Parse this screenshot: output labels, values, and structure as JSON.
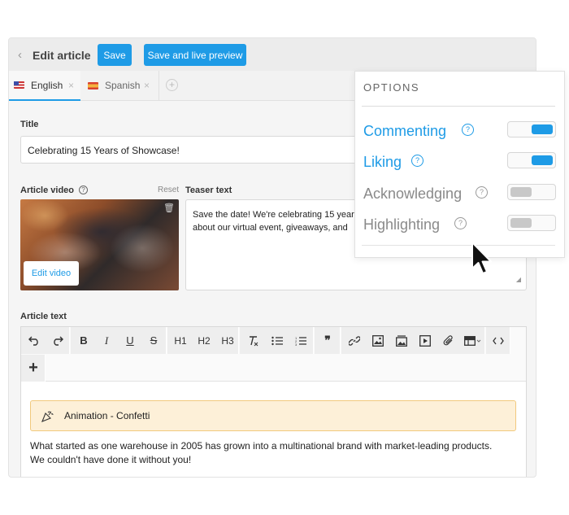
{
  "topbar": {
    "back_icon": "chevron-left-icon",
    "title": "Edit article",
    "save_label": "Save",
    "preview_label": "Save and live preview"
  },
  "tabs": [
    {
      "label": "English",
      "flag": "us-flag-icon",
      "active": true
    },
    {
      "label": "Spanish",
      "flag": "spain-flag-icon",
      "active": false
    }
  ],
  "form": {
    "title_label": "Title",
    "title_value": "Celebrating 15 Years of Showcase!",
    "video_label": "Article video",
    "reset_label": "Reset",
    "edit_video_label": "Edit video",
    "teaser_label": "Teaser text",
    "teaser_line1": "Save the date! We're celebrating 15 year",
    "teaser_line2": "about our virtual event, giveaways, and",
    "article_label": "Article text"
  },
  "editor": {
    "toolbar": {
      "h1": "H1",
      "h2": "H2",
      "h3": "H3",
      "bold": "B",
      "italic": "I",
      "underline": "U",
      "strike": "S",
      "quote": "❞",
      "plus": "+"
    },
    "animation_label": "Animation - Confetti",
    "paragraph_line1": "What started as one warehouse in 2005 has grown into a multinational brand with market-leading products.",
    "paragraph_line2": "We couldn't have done it without you!"
  },
  "options": {
    "title": "OPTIONS",
    "items": [
      {
        "label": "Commenting",
        "enabled": true
      },
      {
        "label": "Liking",
        "enabled": true
      },
      {
        "label": "Acknowledging",
        "enabled": false
      },
      {
        "label": "Highlighting",
        "enabled": false
      }
    ]
  },
  "colors": {
    "accent": "#1e9be6",
    "disabled_text": "#8a8a8a",
    "toggle_off": "#c8c8c8",
    "animation_bg": "#fdf0d8"
  }
}
